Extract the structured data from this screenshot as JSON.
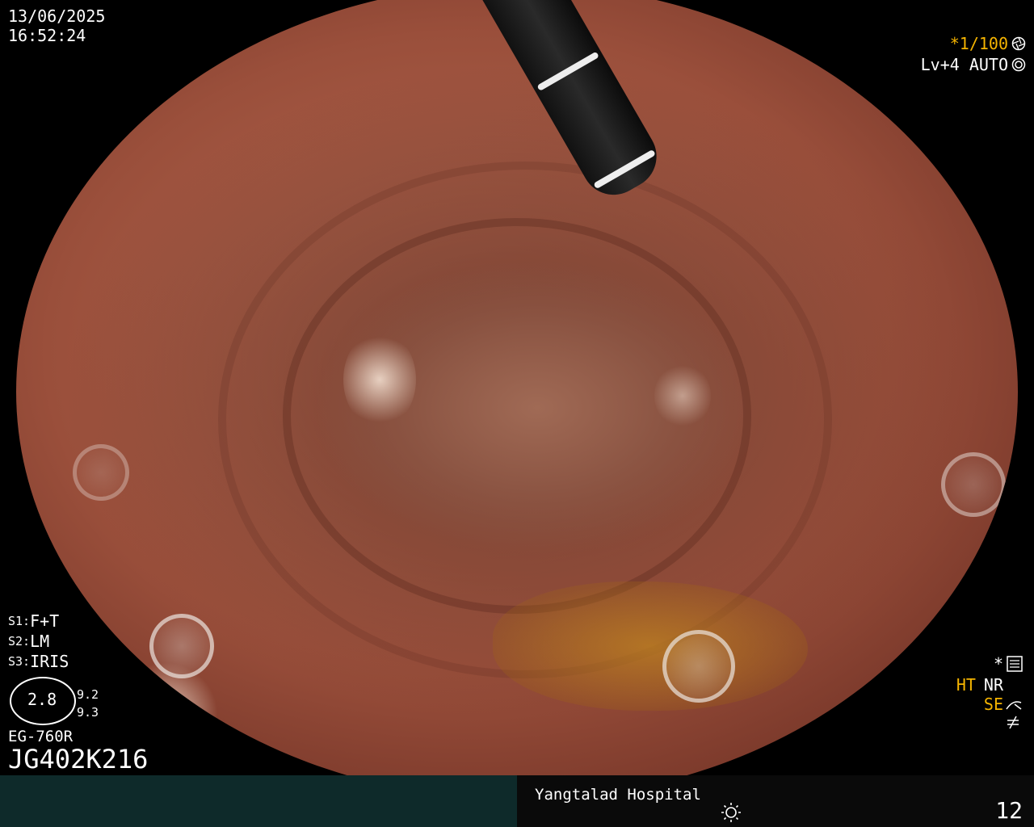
{
  "header": {
    "date": "13/06/2025",
    "time": "16:52:24"
  },
  "top_right": {
    "shutter": "*1/100",
    "shutter_icon": "aperture-icon",
    "level": "Lv+4 AUTO",
    "level_icon": "iris-icon"
  },
  "settings": {
    "s1": "F+T",
    "s2": "LM",
    "s3": "IRIS",
    "s1_label": "S1:",
    "s2_label": "S2:",
    "s3_label": "S3:"
  },
  "meter": {
    "value": "2.8",
    "right_top": "9.2",
    "right_bottom": "9.3"
  },
  "device": {
    "model": "EG-760R",
    "serial": "JG402K216"
  },
  "bottom_right_indicators": {
    "star": "*",
    "ht": "HT",
    "nr": "NR",
    "se": "SE"
  },
  "footer": {
    "hospital": "Yangtalad Hospital",
    "page_number": "12",
    "brightness_icon": "sun-icon"
  },
  "colors": {
    "accent_orange": "#f5b400",
    "footer_left_bg": "#0e2a2a"
  }
}
